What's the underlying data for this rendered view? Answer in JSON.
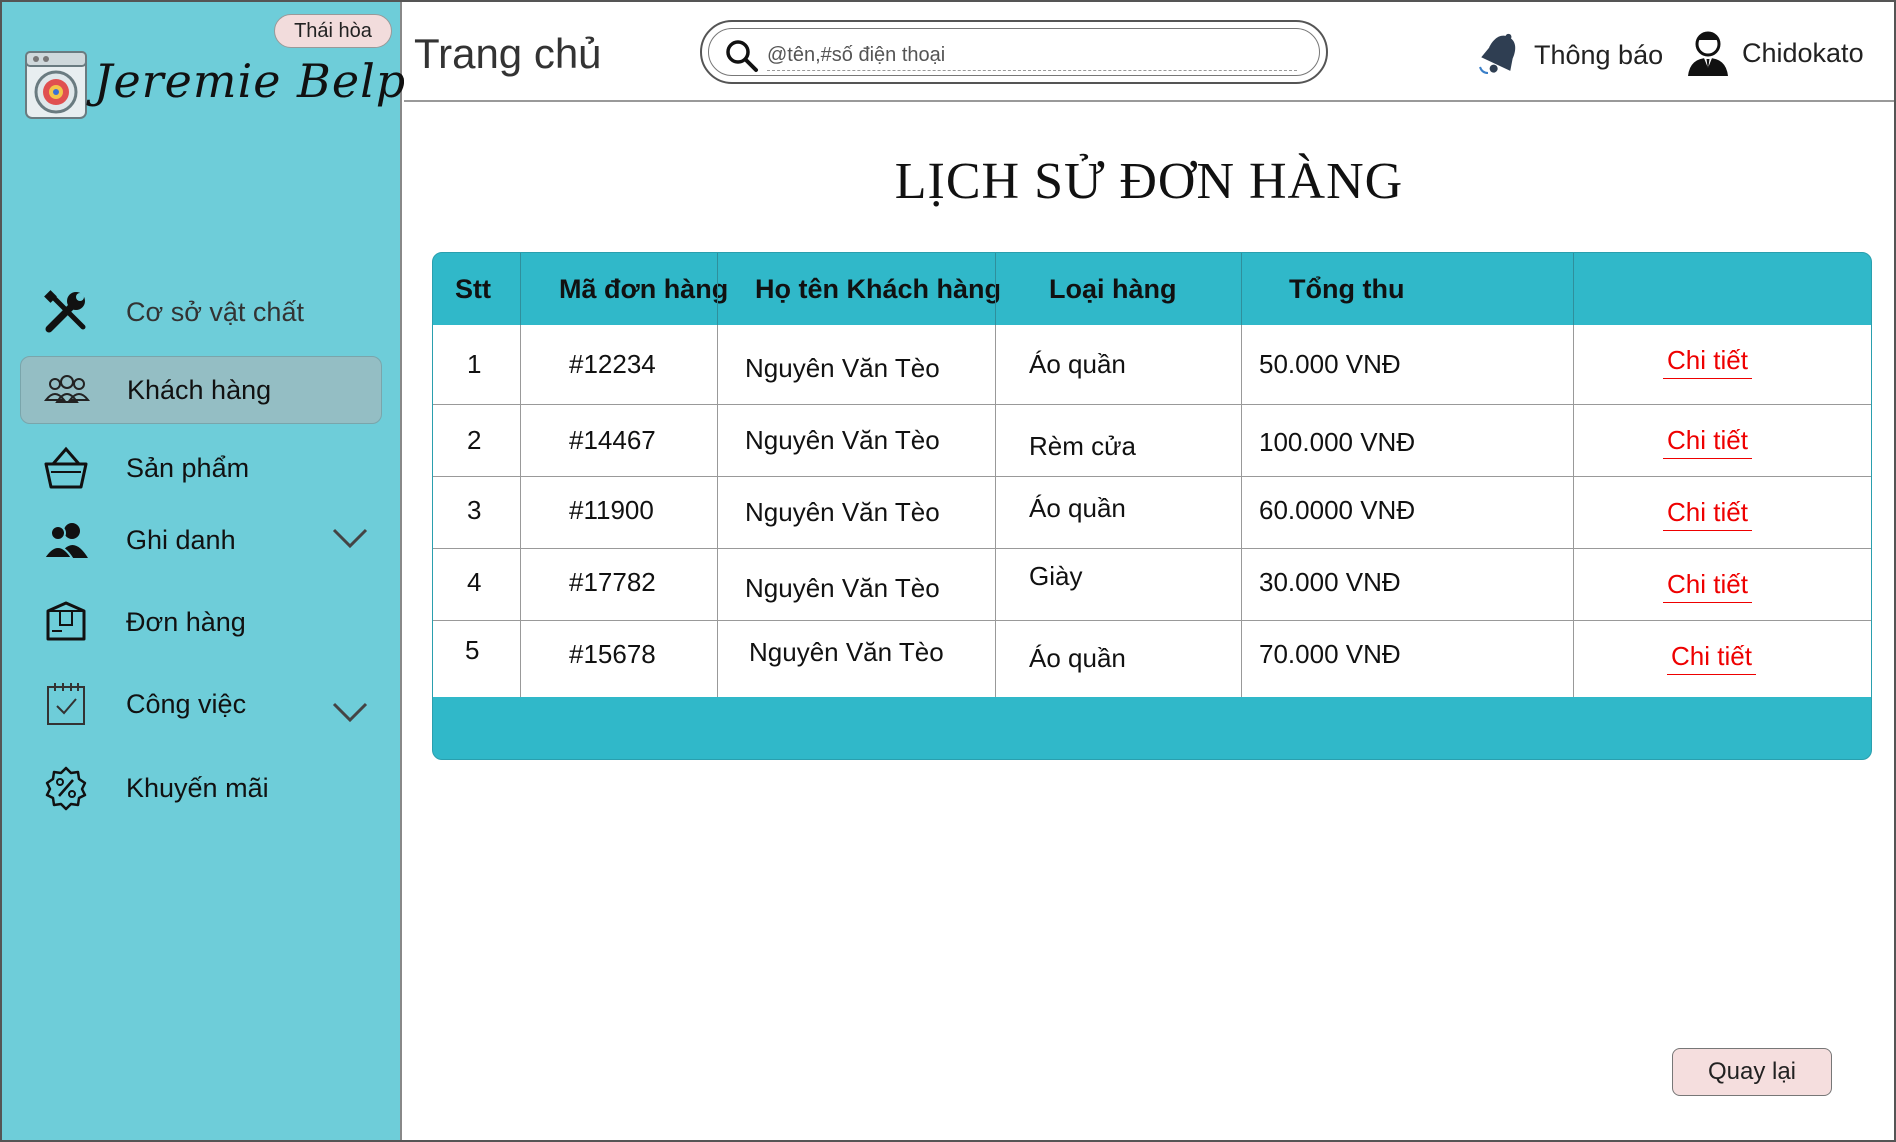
{
  "brand": {
    "name": "Jeremie Belpois",
    "location_badge": "Thái hòa",
    "logo_icon": "washing-machine-icon"
  },
  "sidebar": {
    "items": [
      {
        "label": "Cơ sở vật chất",
        "icon": "wrench-screwdriver-icon",
        "active": false,
        "expandable": false
      },
      {
        "label": "Khách hàng",
        "icon": "customers-icon",
        "active": true,
        "expandable": false
      },
      {
        "label": "Sản phẩm",
        "icon": "basket-icon",
        "active": false,
        "expandable": false
      },
      {
        "label": "Ghi danh",
        "icon": "users-icon",
        "active": false,
        "expandable": true
      },
      {
        "label": "Đơn hàng",
        "icon": "package-icon",
        "active": false,
        "expandable": false
      },
      {
        "label": "Công việc",
        "icon": "calendar-check-icon",
        "active": false,
        "expandable": true
      },
      {
        "label": "Khuyến mãi",
        "icon": "discount-badge-icon",
        "active": false,
        "expandable": false
      }
    ]
  },
  "header": {
    "title": "Trang chủ",
    "search": {
      "placeholder": "@tên,#số điện thoại",
      "value": ""
    },
    "notifications_label": "Thông báo",
    "user_name": "Chidokato"
  },
  "main": {
    "heading": "LỊCH SỬ ĐƠN HÀNG",
    "table": {
      "columns": [
        "Stt",
        "Mã đơn hàng",
        "Họ tên Khách hàng",
        "Loại hàng",
        "Tổng thu",
        ""
      ],
      "rows": [
        {
          "stt": "1",
          "code": "#12234",
          "customer": "Nguyên Văn Tèo",
          "type": "Áo quần",
          "total": "50.000 VNĐ",
          "action": "Chi tiết"
        },
        {
          "stt": "2",
          "code": "#14467",
          "customer": "Nguyên Văn Tèo",
          "type": "Rèm cửa",
          "total": "100.000 VNĐ",
          "action": "Chi tiết"
        },
        {
          "stt": "3",
          "code": "#11900",
          "customer": "Nguyên Văn Tèo",
          "type": "Áo quần",
          "total": "60.0000 VNĐ",
          "action": "Chi tiết"
        },
        {
          "stt": "4",
          "code": "#17782",
          "customer": "Nguyên Văn Tèo",
          "type": "Giày",
          "total": "30.000 VNĐ",
          "action": "Chi tiết"
        },
        {
          "stt": "5",
          "code": "#15678",
          "customer": "Nguyên Văn Tèo",
          "type": "Áo quần",
          "total": "70.000 VNĐ",
          "action": "Chi tiết"
        }
      ]
    },
    "back_label": "Quay lại"
  },
  "colors": {
    "sidebar_bg": "#6ecdd9",
    "active_item_bg": "#94bec4",
    "table_header_bg": "#30b8c9",
    "link_red": "#ee0000",
    "button_bg": "#f5dede"
  }
}
